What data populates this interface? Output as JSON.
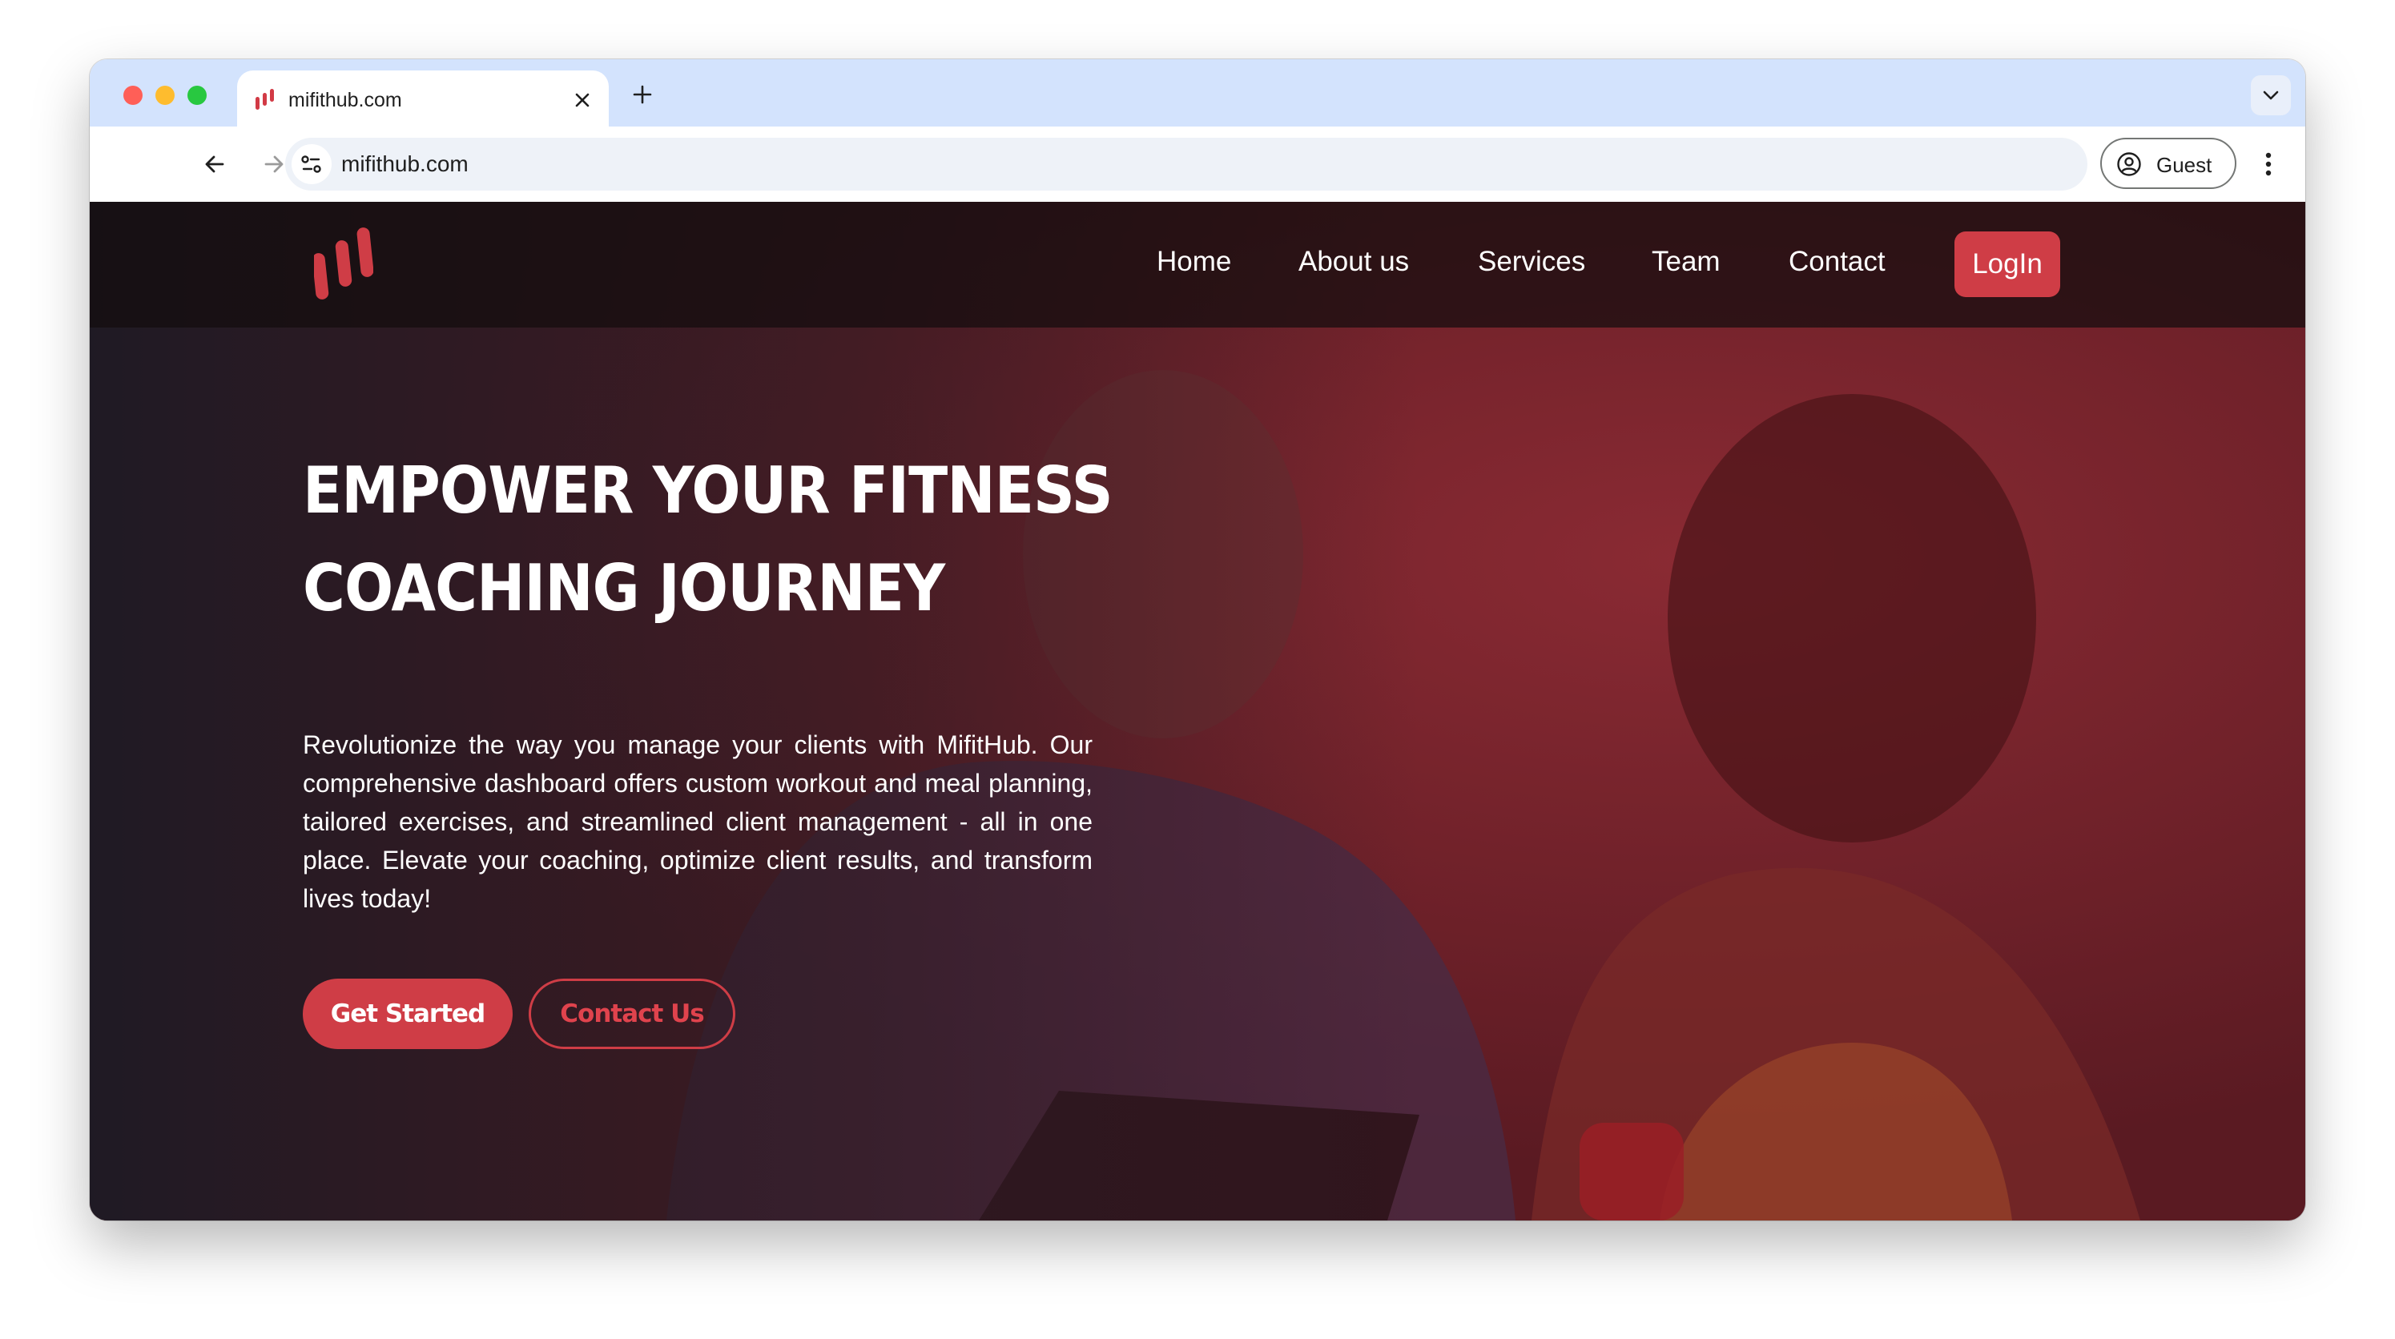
{
  "browser": {
    "tab": {
      "title": "mifithub.com",
      "favicon": "mifithub-logo-icon"
    },
    "address_bar": {
      "url": "mifithub.com"
    },
    "profile": {
      "label": "Guest"
    },
    "icons": [
      "back-arrow-icon",
      "forward-arrow-icon",
      "reload-icon",
      "site-info-icon",
      "close-icon",
      "plus-icon",
      "chevron-down-icon",
      "account-circle-icon",
      "more-vert-icon"
    ]
  },
  "site": {
    "nav": {
      "items": [
        {
          "label": "Home"
        },
        {
          "label": "About us"
        },
        {
          "label": "Services"
        },
        {
          "label": "Team"
        },
        {
          "label": "Contact"
        }
      ],
      "login_label": "LogIn"
    },
    "hero": {
      "title_line1": "EMPOWER YOUR FITNESS",
      "title_line2": "COACHING JOURNEY",
      "description": "Revolutionize the way you manage your clients with MifitHub. Our comprehensive dashboard offers custom workout and meal planning, tailored exercises, and streamlined client management - all in one place. Elevate your coaching, optimize client results, and transform lives today!",
      "primary_cta": "Get Started",
      "secondary_cta": "Contact Us"
    },
    "colors": {
      "brand_red": "#cf3d46",
      "header_overlay": "#140c0e",
      "hero_overlay": "#5a1a22"
    }
  }
}
